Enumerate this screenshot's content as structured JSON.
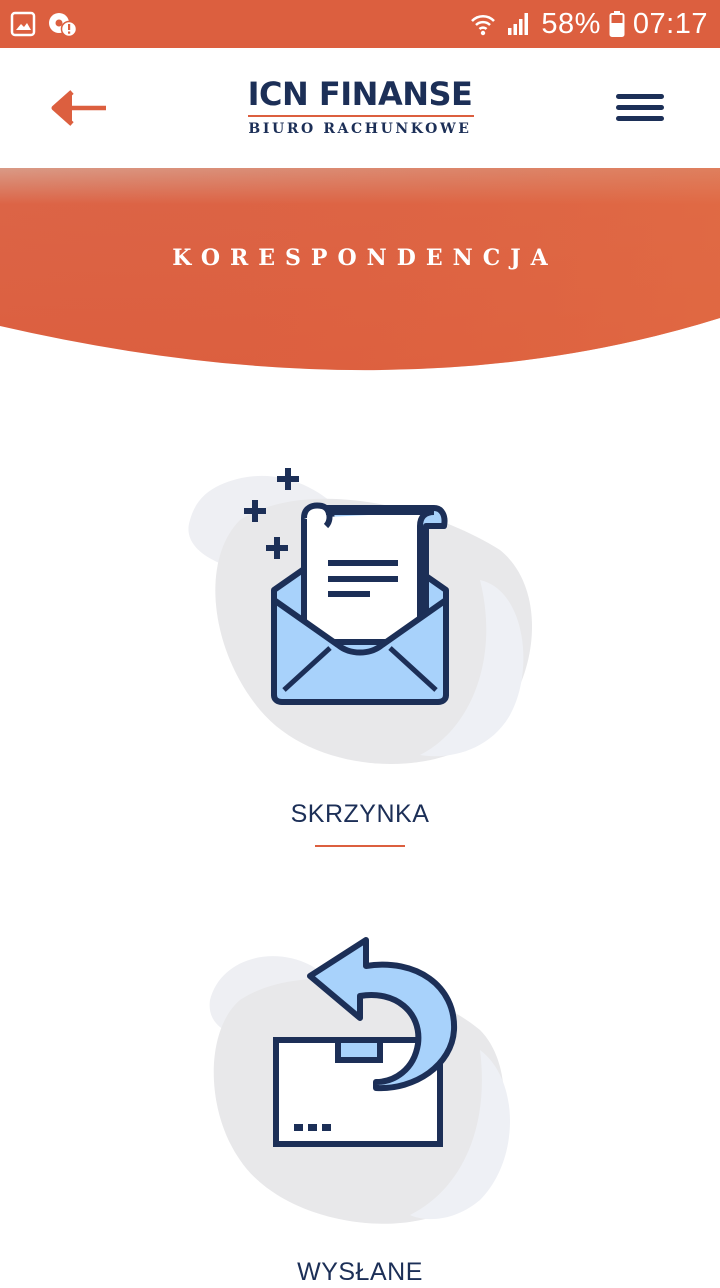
{
  "status_bar": {
    "battery": "58%",
    "time": "07:17",
    "icons": [
      "gallery-notification-icon",
      "sync-alert-icon",
      "wifi-icon",
      "signal-icon",
      "battery-icon"
    ]
  },
  "header": {
    "back_icon": "arrow-left-icon",
    "logo_title": "ICN FINANSE",
    "logo_subtitle": "BIURO RACHUNKOWE",
    "menu_icon": "hamburger-menu-icon"
  },
  "banner": {
    "title": "KORESPONDENCJA"
  },
  "menu": {
    "items": [
      {
        "label": "SKRZYNKA",
        "icon": "open-envelope-letter-icon"
      },
      {
        "label": "WYSŁANE",
        "icon": "sent-box-arrow-icon"
      }
    ]
  },
  "colors": {
    "accent": "#dc5f3f",
    "navy": "#1c2f57",
    "light_blue": "#a8d2fb",
    "blob_gray": "#e8e8ea"
  }
}
